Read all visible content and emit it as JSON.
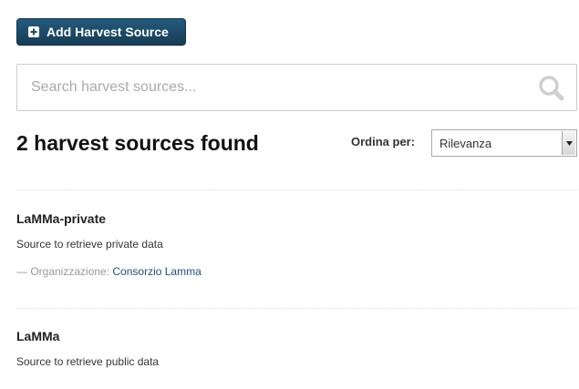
{
  "toolbar": {
    "add_label": "Add Harvest Source"
  },
  "search": {
    "placeholder": "Search harvest sources...",
    "value": ""
  },
  "results": {
    "title": "2 harvest sources found"
  },
  "sort": {
    "label": "Ordina per:",
    "selected": "Rilevanza"
  },
  "items": [
    {
      "title": "LaMMa-private",
      "description": "Source to retrieve private data",
      "org_prefix": "— Organizzazione: ",
      "org_name": "Consorzio Lamma"
    },
    {
      "title": "LaMMa",
      "description": "Source to retrieve public data"
    }
  ],
  "colors": {
    "button_bg": "#1e4a66",
    "link": "#1f4f7a"
  }
}
